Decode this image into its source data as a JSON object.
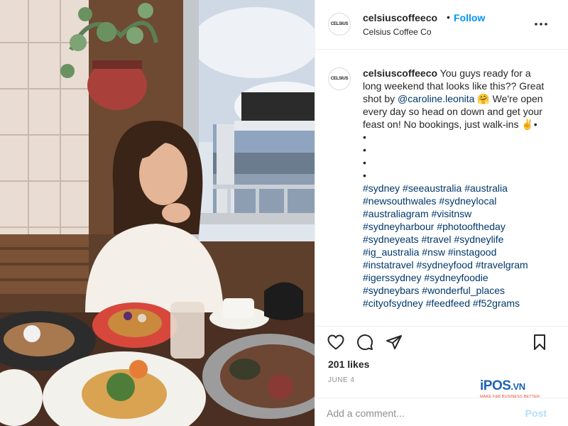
{
  "post": {
    "username": "celsiuscoffeeco",
    "separator": "•",
    "follow_label": "Follow",
    "location": "Celsius Coffee Co",
    "more_icon": "more-horizontal-icon",
    "avatar_text": "CELSIUS",
    "photo_alt": "Woman smiling at a table with breakfast plates by a window"
  },
  "caption": {
    "username": "celsiuscoffeeco",
    "text_before_mention": "You guys ready for a long weekend that looks like this?? Great shot by ",
    "mention": "@caroline.leonita",
    "emoji_after_mention": "🤗",
    "text_after_mention": "We're open every day so head on down and get your feast on! No bookings, just walk-ins ✌️•",
    "bullets": [
      "•",
      "•",
      "•",
      "•"
    ],
    "hashtags": [
      "#sydney",
      "#seeaustralia",
      "#australia",
      "#newsouthwales",
      "#sydneylocal",
      "#australiagram",
      "#visitnsw",
      "#sydneyharbour",
      "#photooftheday",
      "#sydneyeats",
      "#travel",
      "#sydneylife",
      "#ig_australia",
      "#nsw",
      "#instagood",
      "#instatravel",
      "#sydneyfood",
      "#travelgram",
      "#igerssydney",
      "#sydneyfoodie",
      "#sydneybars",
      "#wonderful_places",
      "#cityofsydney",
      "#feedfeed",
      "#f52grams"
    ]
  },
  "actions": {
    "like_icon": "heart-icon",
    "comment_icon": "comment-bubble-icon",
    "share_icon": "paper-plane-icon",
    "save_icon": "bookmark-icon"
  },
  "likes_text": "201 likes",
  "date_text": "JUNE 4",
  "comment": {
    "placeholder": "Add a comment...",
    "post_label": "Post"
  },
  "watermark": {
    "logo_i": "i",
    "logo_pos": "POS",
    "logo_vn": ".VN",
    "tagline": "MAKE F&B BUSINESS BETTER"
  },
  "colors": {
    "link_blue": "#0095f6",
    "hashtag_blue": "#00376b",
    "post_disabled": "#b2dffc",
    "muted": "#8e8e8e"
  }
}
